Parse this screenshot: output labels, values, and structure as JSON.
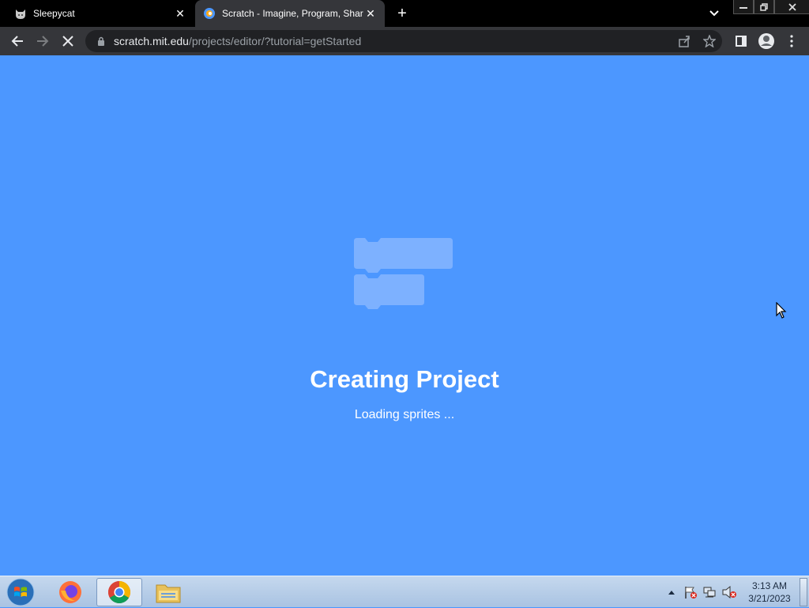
{
  "browser": {
    "tabs": [
      {
        "title": "Sleepycat",
        "active": false,
        "icon": "cat-icon"
      },
      {
        "title": "Scratch - Imagine, Program, Shar",
        "active": true,
        "icon": "scratch-icon"
      }
    ],
    "url": {
      "host": "scratch.mit.edu",
      "path": "/projects/editor/?tutorial=getStarted"
    }
  },
  "page": {
    "title": "Creating Project",
    "message": "Loading sprites ..."
  },
  "taskbar": {
    "apps": [
      "firefox-icon",
      "chrome-icon",
      "file-explorer-icon"
    ],
    "clock": {
      "time": "3:13 AM",
      "date": "3/21/2023"
    }
  },
  "colors": {
    "accent": "#4c97ff",
    "toolbar": "#35363a",
    "tabstrip": "#000000"
  }
}
